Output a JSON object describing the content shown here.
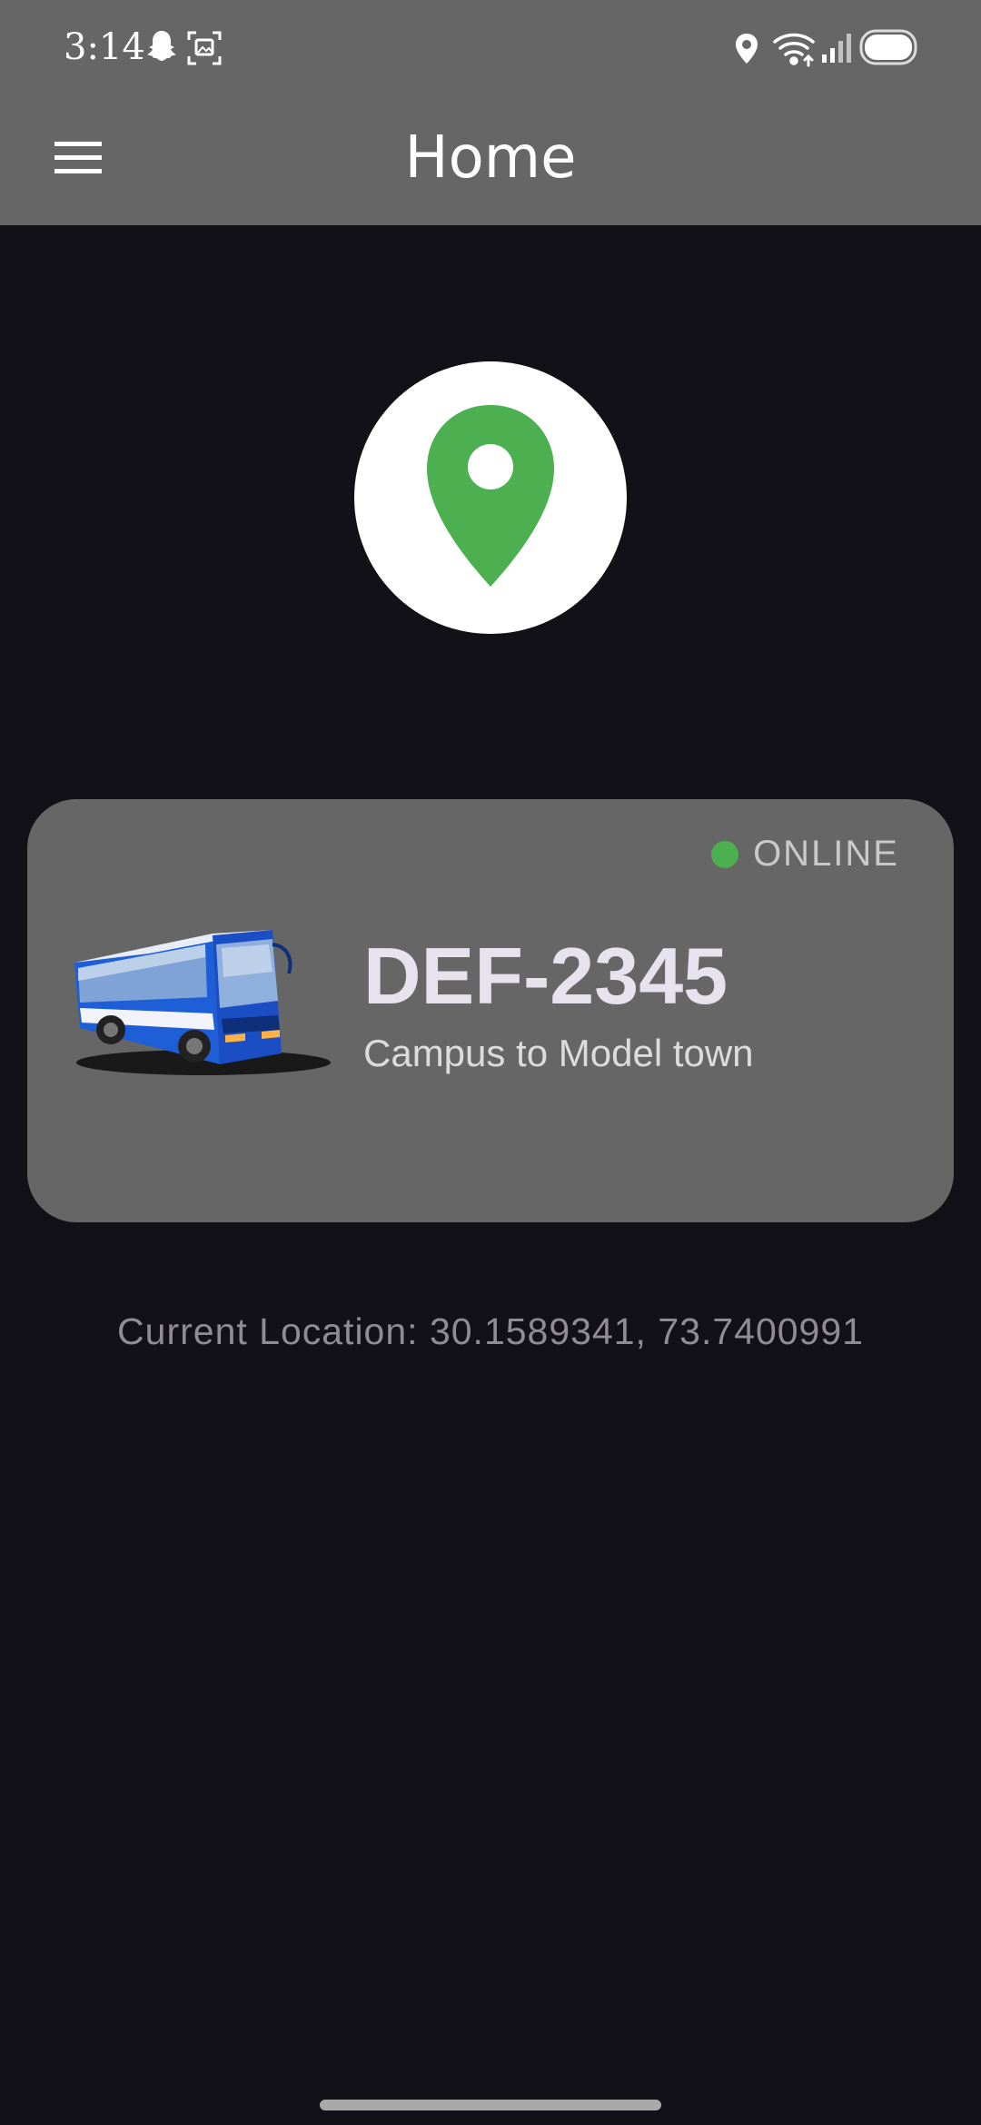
{
  "status_bar": {
    "time": "3:14",
    "icons": [
      "snapchat-icon",
      "screenshot-icon",
      "location-icon",
      "wifi-icon",
      "signal-icon",
      "battery-icon"
    ]
  },
  "app_bar": {
    "title": "Home",
    "menu_icon": "hamburger-menu-icon"
  },
  "hero": {
    "icon": "map-pin-icon",
    "icon_color": "#4caf50"
  },
  "bus_card": {
    "status": "ONLINE",
    "status_color": "#4caf50",
    "plate": "DEF-2345",
    "route": "Campus to Model town",
    "image": "bus-illustration"
  },
  "location": {
    "text": "Current Location: 30.1589341, 73.7400991"
  },
  "colors": {
    "bar": "#666666",
    "background": "#131118",
    "card": "#666666",
    "accent": "#4caf50"
  }
}
